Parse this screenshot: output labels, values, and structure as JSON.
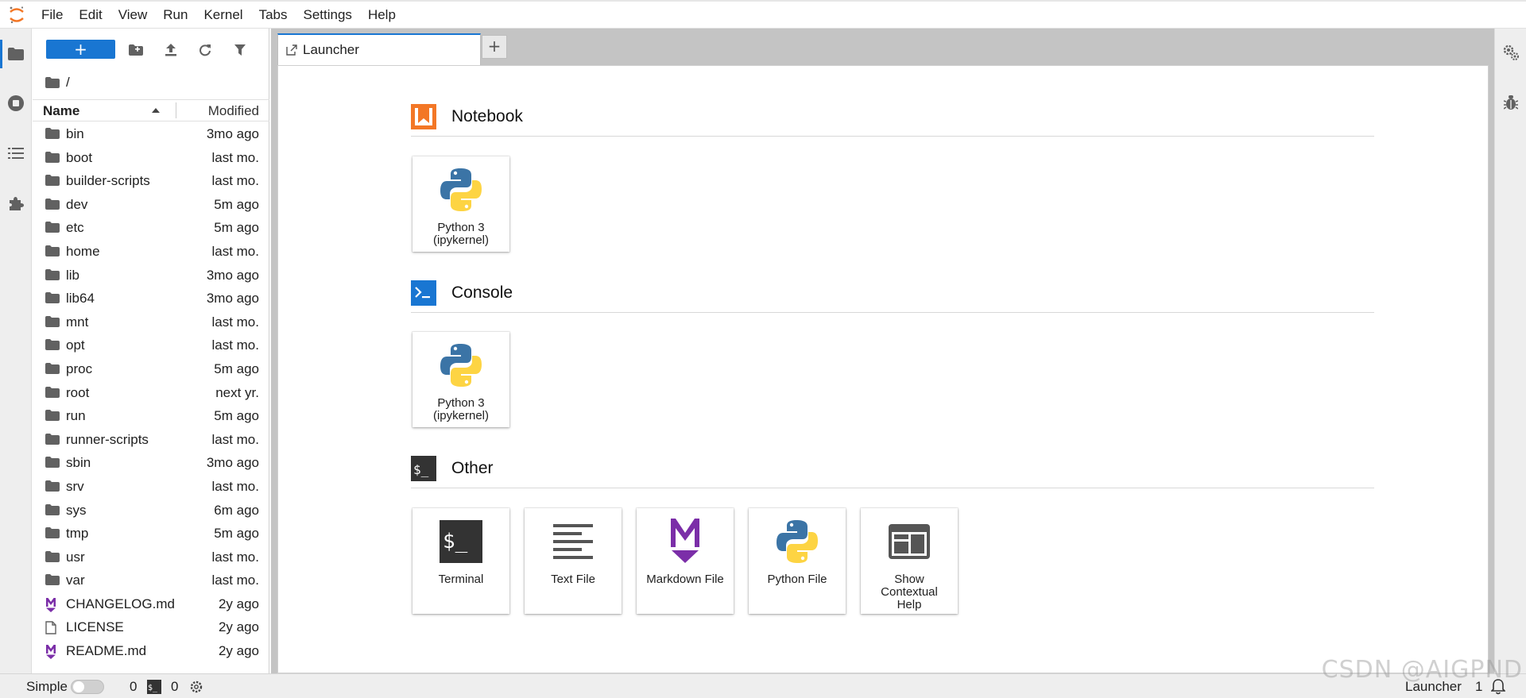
{
  "menu": [
    "File",
    "Edit",
    "View",
    "Run",
    "Kernel",
    "Tabs",
    "Settings",
    "Help"
  ],
  "filebrowser": {
    "new_label": "+",
    "path": "/",
    "columns": {
      "name": "Name",
      "modified": "Modified"
    },
    "files": [
      {
        "name": "bin",
        "modified": "3mo ago",
        "type": "folder"
      },
      {
        "name": "boot",
        "modified": "last mo.",
        "type": "folder"
      },
      {
        "name": "builder-scripts",
        "modified": "last mo.",
        "type": "folder"
      },
      {
        "name": "dev",
        "modified": "5m ago",
        "type": "folder"
      },
      {
        "name": "etc",
        "modified": "5m ago",
        "type": "folder"
      },
      {
        "name": "home",
        "modified": "last mo.",
        "type": "folder"
      },
      {
        "name": "lib",
        "modified": "3mo ago",
        "type": "folder"
      },
      {
        "name": "lib64",
        "modified": "3mo ago",
        "type": "folder"
      },
      {
        "name": "mnt",
        "modified": "last mo.",
        "type": "folder"
      },
      {
        "name": "opt",
        "modified": "last mo.",
        "type": "folder"
      },
      {
        "name": "proc",
        "modified": "5m ago",
        "type": "folder"
      },
      {
        "name": "root",
        "modified": "next yr.",
        "type": "folder"
      },
      {
        "name": "run",
        "modified": "5m ago",
        "type": "folder"
      },
      {
        "name": "runner-scripts",
        "modified": "last mo.",
        "type": "folder"
      },
      {
        "name": "sbin",
        "modified": "3mo ago",
        "type": "folder"
      },
      {
        "name": "srv",
        "modified": "last mo.",
        "type": "folder"
      },
      {
        "name": "sys",
        "modified": "6m ago",
        "type": "folder"
      },
      {
        "name": "tmp",
        "modified": "5m ago",
        "type": "folder"
      },
      {
        "name": "usr",
        "modified": "last mo.",
        "type": "folder"
      },
      {
        "name": "var",
        "modified": "last mo.",
        "type": "folder"
      },
      {
        "name": "CHANGELOG.md",
        "modified": "2y ago",
        "type": "markdown"
      },
      {
        "name": "LICENSE",
        "modified": "2y ago",
        "type": "file"
      },
      {
        "name": "README.md",
        "modified": "2y ago",
        "type": "markdown"
      }
    ]
  },
  "tabs": {
    "launcher_label": "Launcher",
    "add_label": "+"
  },
  "launcher": {
    "sections": {
      "notebook": "Notebook",
      "console": "Console",
      "other": "Other"
    },
    "notebook_card": {
      "line1": "Python 3",
      "line2": "(ipykernel)"
    },
    "console_card": {
      "line1": "Python 3",
      "line2": "(ipykernel)"
    },
    "other_cards": {
      "terminal": "Terminal",
      "text_file": "Text File",
      "markdown_file": "Markdown File",
      "python_file": "Python File",
      "help_line1": "Show",
      "help_line2": "Contextual",
      "help_line3": "Help"
    }
  },
  "statusbar": {
    "mode": "Simple",
    "kernels": "0",
    "terminals": "0",
    "active": "Launcher",
    "notifications": "1"
  },
  "watermark": "CSDN @AIGPND",
  "colors": {
    "accent": "#1976d2",
    "notebook": "#f37726",
    "markdown": "#7b2ea8",
    "terminal": "#333333"
  }
}
